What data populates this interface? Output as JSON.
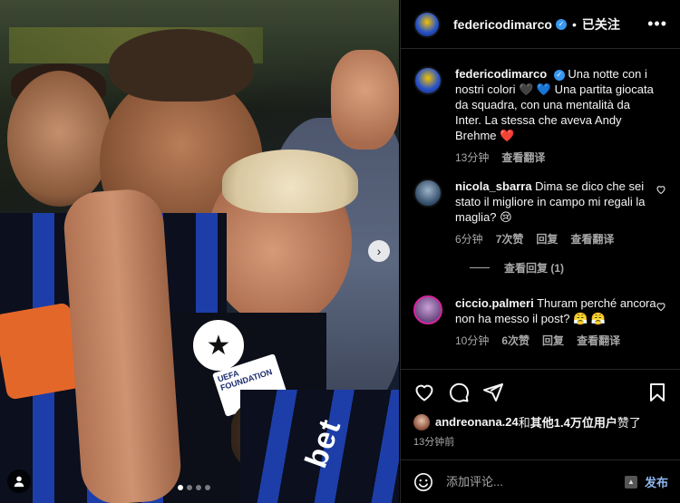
{
  "photo": {
    "badge_text": "UEFA FOUNDATION",
    "shirt_text": "bet",
    "carousel_count": 4,
    "carousel_active": 0
  },
  "header": {
    "username": "federicodimarco",
    "separator": "•",
    "follow_label": "已关注",
    "more_label": "•••"
  },
  "caption": {
    "username": "federicodimarco",
    "text": "Una notte con i nostri colori 🖤 💙 Una partita giocata da squadra, con una mentalità da Inter. La stessa che aveva Andy Brehme ❤️",
    "time": "13分钟",
    "translate": "查看翻译"
  },
  "comments": [
    {
      "username": "nicola_sbarra",
      "text": "Dima se dico che sei stato il migliore in campo mi regali la maglia? 😢",
      "time": "6分钟",
      "likes": "7次赞",
      "reply": "回复",
      "translate": "查看翻译",
      "view_replies": "查看回复 (1)"
    },
    {
      "username": "ciccio.palmeri",
      "text": "Thuram perché ancora non ha messo il post? 😤 😤",
      "time": "10分钟",
      "likes": "6次赞",
      "reply": "回复",
      "translate": "查看翻译"
    }
  ],
  "likes": {
    "user": "andreonana.24",
    "conj": "和",
    "others": "其他1.4万位用户",
    "suffix": "赞了"
  },
  "post_time": "13分钟前",
  "composer": {
    "placeholder": "添加评论...",
    "post_label": "发布"
  }
}
